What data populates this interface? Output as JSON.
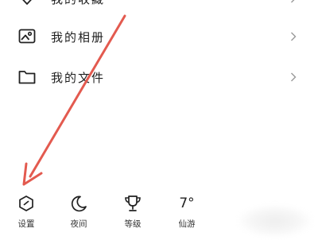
{
  "menu": {
    "items": [
      {
        "label": "我的收藏",
        "icon": "heart-icon"
      },
      {
        "label": "我的相册",
        "icon": "photo-album-icon"
      },
      {
        "label": "我的文件",
        "icon": "folder-icon"
      }
    ]
  },
  "bottom_bar": {
    "settings_label": "设置",
    "night_label": "夜间",
    "level_label": "等级",
    "weather_label": "仙游",
    "weather_temp": "7°"
  },
  "annotation": {
    "arrow_color": "#e35a4f"
  }
}
